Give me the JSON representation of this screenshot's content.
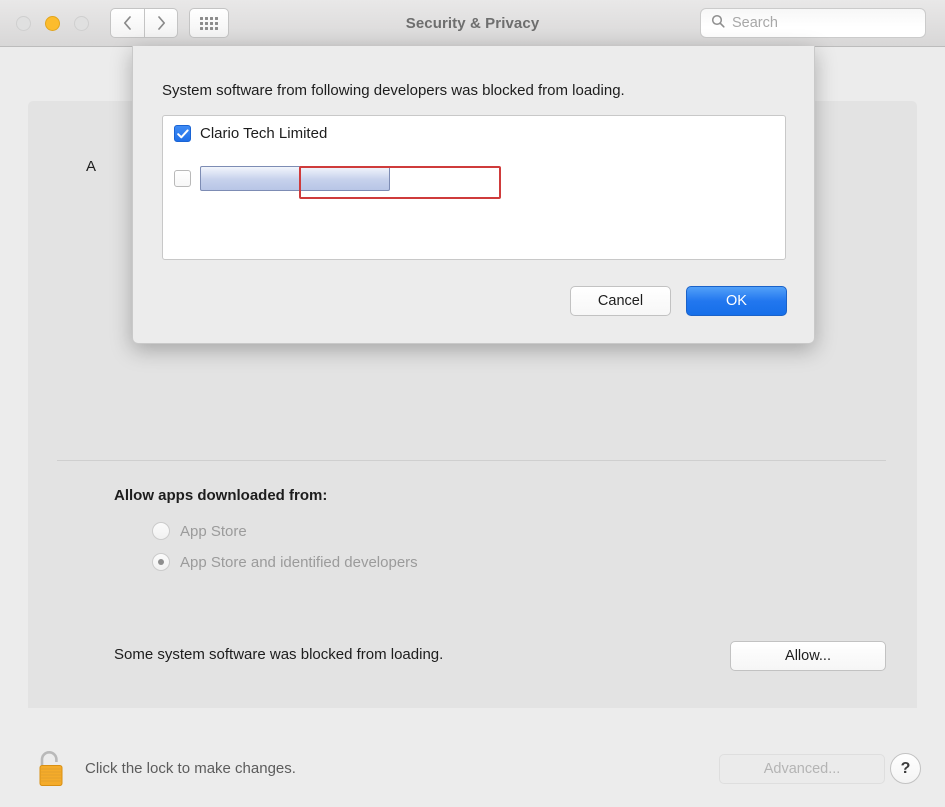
{
  "window": {
    "title": "Security & Privacy",
    "traffic_lights": {
      "close_label": "close",
      "minimize_label": "minimize",
      "zoom_label": "zoom",
      "minimize_color": "#fcbc2d",
      "inactive_color": "#e0e0e0"
    },
    "nav": {
      "back_label": "Back",
      "forward_label": "Forward",
      "grid_label": "Show All"
    },
    "search": {
      "placeholder": "Search",
      "value": "",
      "icon": "search-icon"
    }
  },
  "pane": {
    "obscured_text": "A",
    "allow_apps_label": "Allow apps downloaded from:",
    "radio_options": [
      {
        "label": "App Store",
        "selected": false,
        "disabled": true
      },
      {
        "label": "App Store and identified developers",
        "selected": true,
        "disabled": true
      }
    ],
    "blocked_notice": "Some system software was blocked from loading.",
    "allow_button_label": "Allow..."
  },
  "footer": {
    "lock_icon": "open-padlock-icon",
    "lock_text": "Click the lock to make changes.",
    "advanced_label": "Advanced...",
    "advanced_disabled": true,
    "help_label": "?"
  },
  "sheet": {
    "heading": "System software from following developers was blocked from loading.",
    "developers": [
      {
        "name": "Clario Tech Limited",
        "checked": true,
        "redacted": false,
        "highlighted": true
      },
      {
        "name": "",
        "checked": false,
        "redacted": true,
        "highlighted": false
      }
    ],
    "cancel_label": "Cancel",
    "ok_label": "OK",
    "accent_color": "#1f6fe8",
    "highlight_color": "#cf3b3b"
  }
}
